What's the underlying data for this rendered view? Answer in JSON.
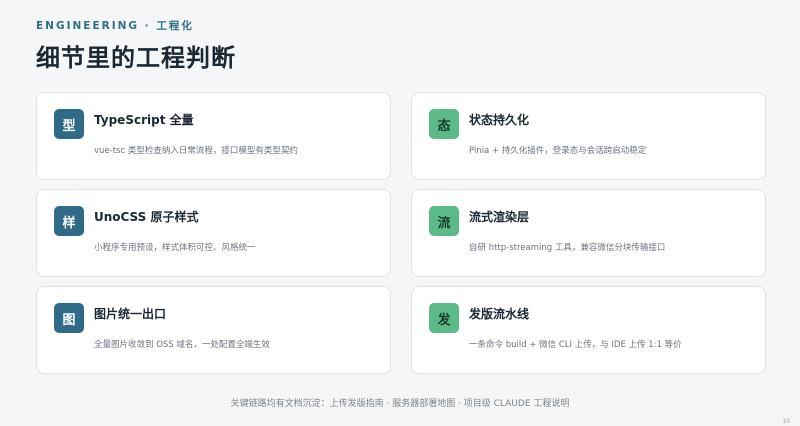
{
  "header": {
    "eyebrow": "ENGINEERING · 工程化",
    "title": "细节里的工程判断"
  },
  "cards": [
    {
      "icon_char": "型",
      "icon_color": "#2f6b87",
      "title": "TypeScript 全量",
      "desc": "vue-tsc 类型检查纳入日常流程，接口模型有类型契约"
    },
    {
      "icon_char": "态",
      "icon_color": "#5bba87",
      "title": "状态持久化",
      "desc": "Pinia + 持久化插件，登录态与会话跨启动稳定"
    },
    {
      "icon_char": "样",
      "icon_color": "#2f6b87",
      "title": "UnoCSS 原子样式",
      "desc": "小程序专用预设，样式体积可控、风格统一"
    },
    {
      "icon_char": "流",
      "icon_color": "#5bba87",
      "title": "流式渲染层",
      "desc": "自研 http-streaming 工具，兼容微信分块传输接口"
    },
    {
      "icon_char": "图",
      "icon_color": "#2f6b87",
      "title": "图片统一出口",
      "desc": "全量图片收敛到 OSS 域名，一处配置全端生效"
    },
    {
      "icon_char": "发",
      "icon_color": "#5bba87",
      "title": "发版流水线",
      "desc": "一条命令 build + 微信 CLI 上传，与 IDE 上传 1:1 等价"
    }
  ],
  "footer": {
    "text": "关键链路均有文档沉淀：上传发版指南 · 服务器部署地图 · 项目级 CLAUDE 工程说明"
  },
  "page_number": "10"
}
